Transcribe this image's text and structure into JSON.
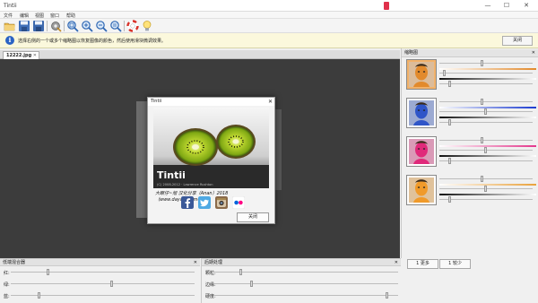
{
  "window": {
    "title": "Tintii",
    "ctl_min": "—",
    "ctl_max": "☐",
    "ctl_close": "✕"
  },
  "menu": [
    "文件",
    "编辑",
    "视图",
    "窗口",
    "帮助"
  ],
  "toolbar": {
    "icons": [
      "open-icon",
      "save-icon",
      "save-as-icon",
      "settings-icon",
      "zoom-fit-icon",
      "zoom-in-icon",
      "zoom-out-icon",
      "zoom-actual-icon",
      "help-icon",
      "tips-icon"
    ]
  },
  "infobar": {
    "icon_glyph": "i",
    "message": "选择右侧的一个或多个缩略图以恢复图像的颜色，然后使用滑块微调效果。",
    "close_label": "关闭"
  },
  "document": {
    "tab_label": "12222.jpg",
    "tab_close": "✕"
  },
  "about": {
    "title": "Tintii",
    "close_glyph": "✕",
    "app_name": "Tintii",
    "version_line": "(C) 2008-2012 · Lawrence Rushton",
    "credit": "大眼仔~旭 汉化分享（Anan）2018（www.dayanzai.me）",
    "social": [
      "facebook-icon",
      "twitter-icon",
      "instagram-icon",
      "flickr-icon"
    ],
    "close_label": "关闭"
  },
  "thumb_panel": {
    "title": "缩略图",
    "close_glyph": "✕",
    "more_label": "1 更多",
    "fewer_label": "1 较少",
    "thumbs": [
      {
        "name": "orange",
        "color": "#e28a2c",
        "selected": true,
        "sliders": [
          0.46,
          0.04,
          0.1
        ],
        "gradient_end": "#e28a2c"
      },
      {
        "name": "blue",
        "color": "#2f55c8",
        "selected": false,
        "sliders": [
          0.46,
          0.5,
          0.1
        ],
        "gradient_end": "#1b3bd0"
      },
      {
        "name": "pink",
        "color": "#e0297a",
        "selected": false,
        "sliders": [
          0.46,
          0.5,
          0.1
        ],
        "gradient_end": "#e3388c"
      },
      {
        "name": "amber",
        "color": "#f09a2a",
        "selected": false,
        "sliders": [
          0.46,
          0.5,
          0.1
        ],
        "gradient_end": "#e9a23c"
      }
    ]
  },
  "bottom_left": {
    "title": "低端混合器",
    "close_glyph": "✕",
    "rows": [
      {
        "label": "红:",
        "value": 0.2
      },
      {
        "label": "绿:",
        "value": 0.55
      },
      {
        "label": "蓝:",
        "value": 0.15
      }
    ]
  },
  "bottom_right": {
    "title": "后期处理",
    "close_glyph": "✕",
    "rows": [
      {
        "label": "颗粒:",
        "value": 0.14
      },
      {
        "label": "边缘:",
        "value": 0.2
      },
      {
        "label": "硬度:",
        "value": 0.95
      }
    ]
  }
}
